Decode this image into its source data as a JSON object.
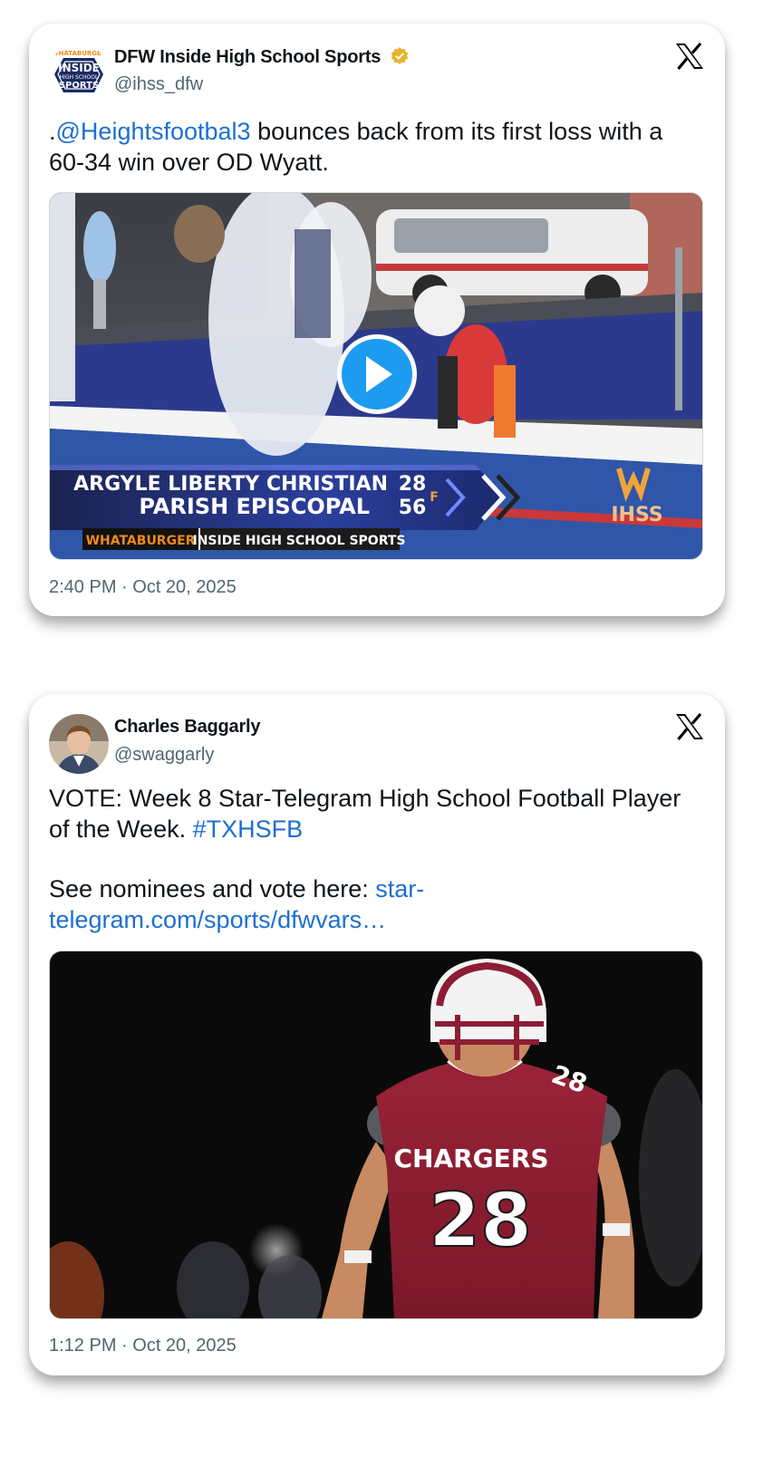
{
  "tweets": [
    {
      "author_name": "DFW Inside High School Sports",
      "handle": "@ihss_dfw",
      "verified": true,
      "avatar_logo": {
        "top": "WHATABURGER",
        "line1": "INSIDE",
        "line2": "HIGH SCHOOL",
        "line3": "SPORTS"
      },
      "text_prefix": ".",
      "mention": "@Heightsfootbal3",
      "text_line1_rest": " bounces back from its first loss with a",
      "text_line2": "60-34 win over OD Wyatt.",
      "media": {
        "type": "video",
        "scoreboard": {
          "team1": "ARGYLE LIBERTY CHRISTIAN",
          "score1": "28",
          "team2": "PARISH EPISCOPAL",
          "score2": "56",
          "status": "F",
          "sponsor": "WHATABURGER",
          "network": "INSIDE HIGH SCHOOL SPORTS",
          "watermark": "IHSS"
        }
      },
      "timestamp": "2:40 PM · Oct 20, 2025"
    },
    {
      "author_name": "Charles Baggarly",
      "handle": "@swaggarly",
      "verified": false,
      "text_line1": "VOTE: Week 8 Star-Telegram High School Football Player",
      "text_line2_plain": "of the Week. ",
      "hashtag": "#TXHSFB",
      "text_line3_plain": "See nominees and vote here: ",
      "link_part1": "star-",
      "link_part2": "telegram.com/sports/dfwvars…",
      "media": {
        "type": "photo",
        "jersey_team": "CHARGERS",
        "jersey_number": "28"
      },
      "timestamp": "1:12 PM · Oct 20, 2025"
    }
  ],
  "colors": {
    "link": "#1d6fd1",
    "text": "#0f1419",
    "secondary": "#536471",
    "verified": "#e8b32d",
    "play_button": "#1d9bf0",
    "jersey": "#8c1d33"
  },
  "icons": [
    "x-logo-icon",
    "verified-badge-icon",
    "play-icon"
  ]
}
